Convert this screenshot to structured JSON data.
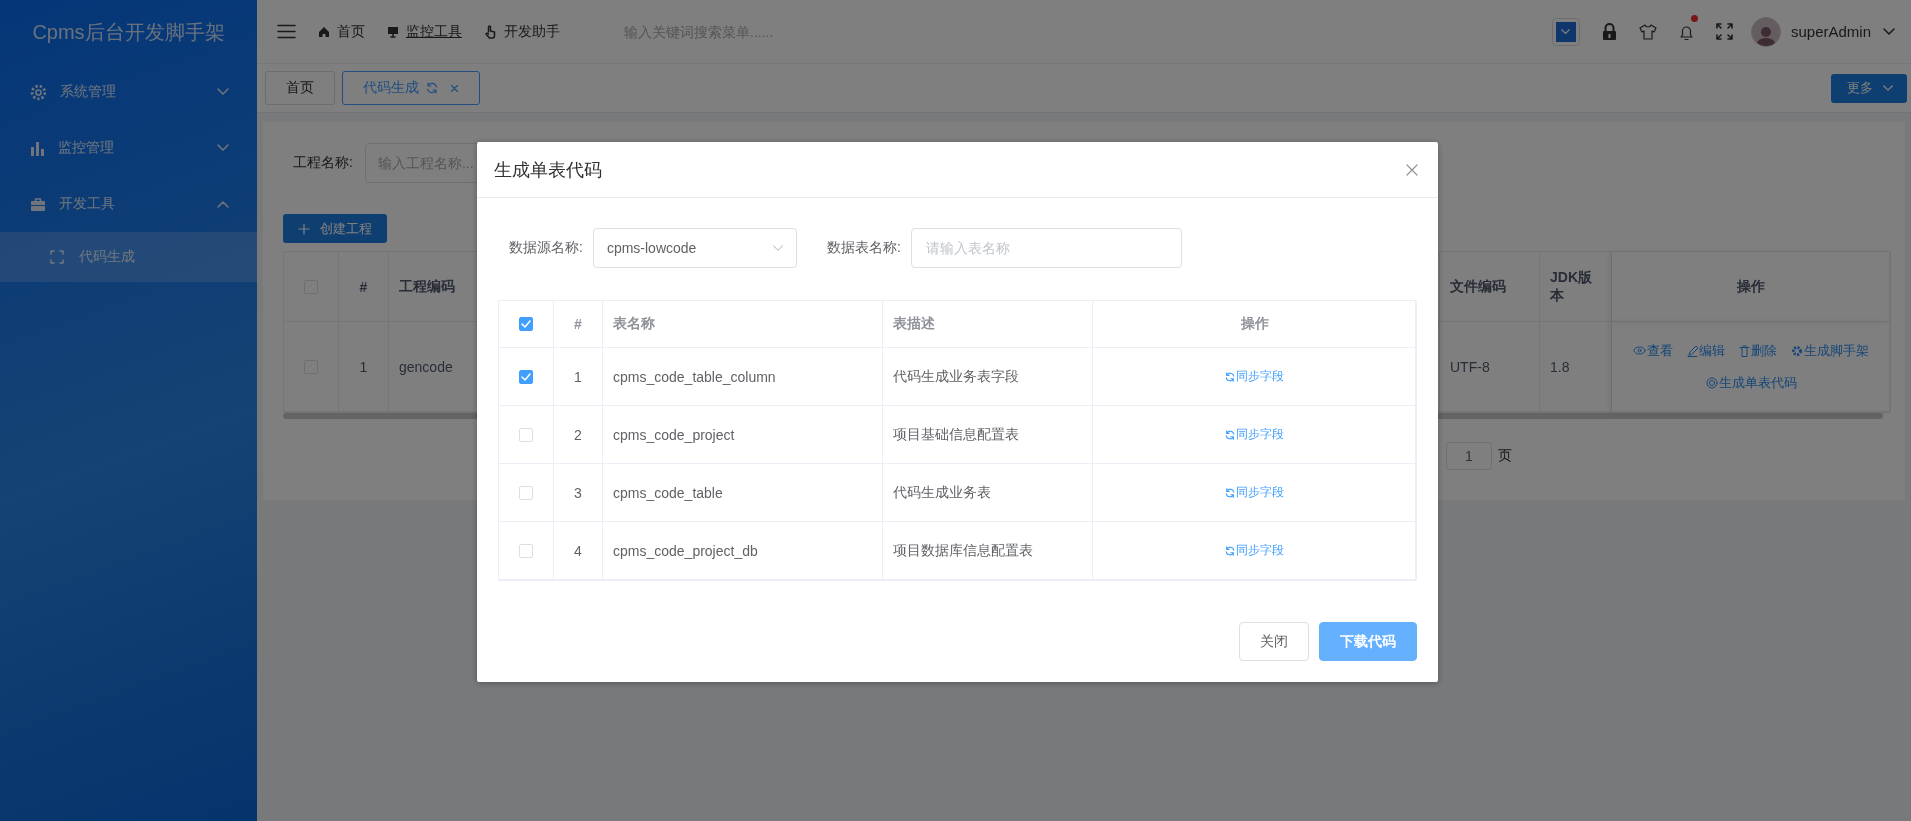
{
  "sidebar": {
    "title": "Cpms后台开发脚手架",
    "menu": [
      {
        "label": "系统管理",
        "expanded": false
      },
      {
        "label": "监控管理",
        "expanded": false
      },
      {
        "label": "开发工具",
        "expanded": true,
        "children": [
          {
            "label": "代码生成",
            "selected": true
          }
        ]
      }
    ]
  },
  "topbar": {
    "nav": [
      {
        "label": "首页",
        "selected": false
      },
      {
        "label": "监控工具",
        "selected": true
      },
      {
        "label": "开发助手",
        "selected": false
      }
    ],
    "search": {
      "placeholder": "输入关键词搜索菜单......"
    },
    "notification_badge": true,
    "user": {
      "name": "superAdmin"
    }
  },
  "tabs": [
    {
      "label": "首页",
      "selected": false,
      "closable": false
    },
    {
      "label": "代码生成",
      "selected": true,
      "closable": true
    }
  ],
  "more_button": "更多",
  "project_panel": {
    "filter": {
      "label": "工程名称:",
      "placeholder": "输入工程名称..."
    },
    "create_button": "创建工程",
    "table": {
      "header_checked": false,
      "columns": [
        "#",
        "工程编码",
        "文件编码",
        "JDK版本",
        "操作"
      ],
      "rows": [
        {
          "checked": false,
          "no": "1",
          "code": "gencode",
          "encoding": "UTF-8",
          "jdk": "1.8",
          "actions": [
            "查看",
            "编辑",
            "删除",
            "生成脚手架",
            "生成单表代码"
          ]
        }
      ]
    },
    "pagination": {
      "page": "1",
      "unit": "页"
    }
  },
  "dialog": {
    "title": "生成单表代码",
    "datasource": {
      "label": "数据源名称:",
      "value": "cpms-lowcode"
    },
    "table_name": {
      "label": "数据表名称:",
      "placeholder": "请输入表名称"
    },
    "table": {
      "header_checked": true,
      "columns": [
        "#",
        "表名称",
        "表描述",
        "操作"
      ],
      "rows": [
        {
          "checked": true,
          "no": "1",
          "name": "cpms_code_table_column",
          "description": "代码生成业务表字段",
          "action": "同步字段"
        },
        {
          "checked": false,
          "no": "2",
          "name": "cpms_code_project",
          "description": "项目基础信息配置表",
          "action": "同步字段"
        },
        {
          "checked": false,
          "no": "3",
          "name": "cpms_code_table",
          "description": "代码生成业务表",
          "action": "同步字段"
        },
        {
          "checked": false,
          "no": "4",
          "name": "cpms_code_project_db",
          "description": "项目数据库信息配置表",
          "action": "同步字段"
        }
      ]
    },
    "buttons": [
      {
        "label": "关闭",
        "kind": "default"
      },
      {
        "label": "下载代码",
        "kind": "primary"
      }
    ]
  }
}
